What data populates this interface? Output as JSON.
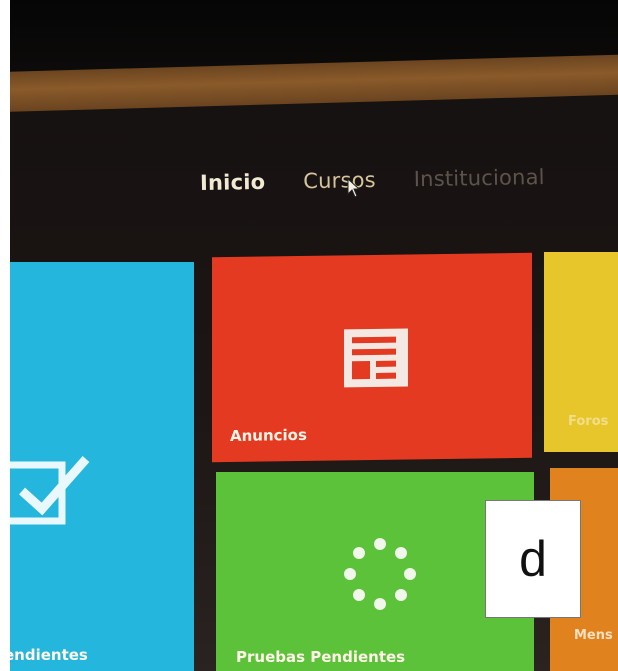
{
  "nav": {
    "items": [
      {
        "label": "Inicio",
        "state": "active"
      },
      {
        "label": "Cursos",
        "state": "normal"
      },
      {
        "label": "Institucional",
        "state": "dim"
      }
    ]
  },
  "tiles": {
    "blue": {
      "label": "endientes",
      "color": "#24b6dc",
      "icon": "checkbox-checked-icon"
    },
    "red": {
      "label": "Anuncios",
      "color": "#e53a22",
      "icon": "newspaper-icon"
    },
    "yellow": {
      "label": "Foros",
      "color": "#e6c62a"
    },
    "green": {
      "label": "Pruebas Pendientes",
      "color": "#5cc23a",
      "icon": "loading-dots-icon"
    },
    "orange": {
      "label": "Mens",
      "color": "#e0821e"
    }
  },
  "overlay": {
    "letter": "d"
  }
}
